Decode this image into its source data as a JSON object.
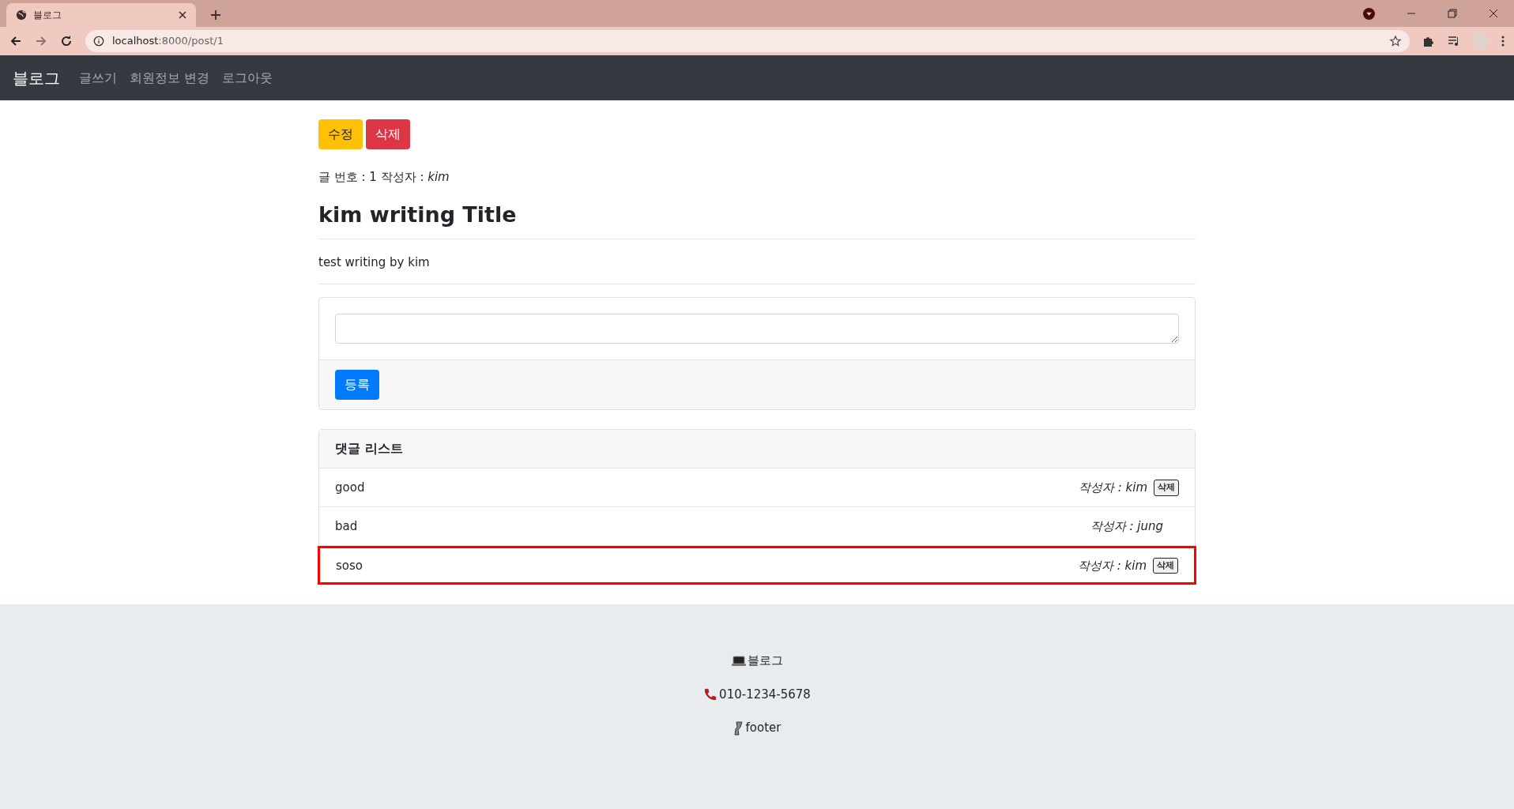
{
  "browser": {
    "tab_title": "블로그",
    "url_host": "localhost",
    "url_path": ":8000/post/1"
  },
  "navbar": {
    "brand": "블로그",
    "links": [
      "글쓰기",
      "회원정보 변경",
      "로그아웃"
    ]
  },
  "post": {
    "buttons": [
      {
        "label": "수정",
        "kind": "edit"
      },
      {
        "label": "삭제",
        "kind": "delete"
      }
    ],
    "meta": "글 번호 : 1 작성자 : *kim*",
    "title": "kim writing Title",
    "content": "test writing by kim"
  },
  "reply_form": {
    "submit": "등록"
  },
  "comments": {
    "header": "댓글 리스트",
    "items": [
      {
        "text": "good",
        "author": "작성자 : kim",
        "delete": "삭제",
        "highlighted": false
      },
      {
        "text": "bad",
        "author": "작성자 : jung",
        "highlighted": false
      },
      {
        "text": "soso",
        "author": "작성자 : kim",
        "delete": "삭제",
        "highlighted": true
      }
    ]
  },
  "footer": [
    {
      "kind": "laptop",
      "text": "블로그"
    },
    {
      "kind": "phone",
      "text": "010-1234-5678"
    },
    {
      "kind": "leg",
      "text": "footer"
    }
  ]
}
